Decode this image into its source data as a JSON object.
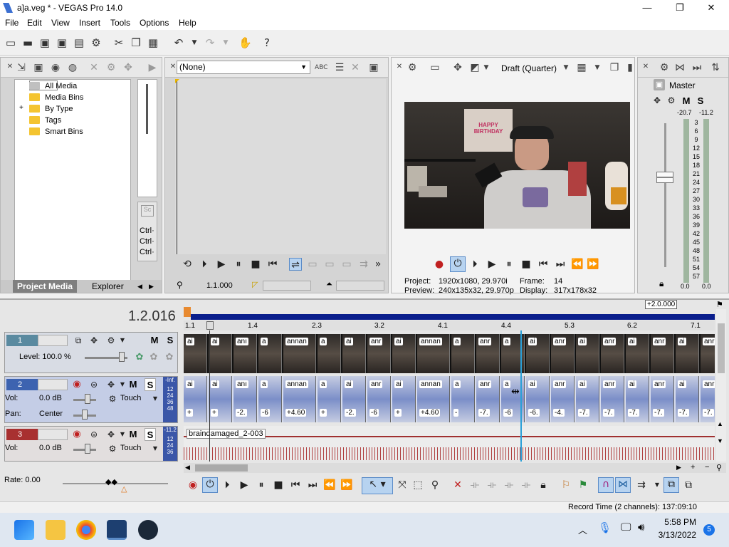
{
  "window": {
    "title": "a]a.veg * - VEGAS Pro 14.0",
    "minimize": "—",
    "maximize": "❐",
    "close": "✕"
  },
  "menu": [
    "File",
    "Edit",
    "View",
    "Insert",
    "Tools",
    "Options",
    "Help"
  ],
  "toolbar_icons": [
    "new-icon",
    "open-icon",
    "save-icon",
    "save-as-icon",
    "render-icon",
    "properties-icon",
    "cut-icon",
    "copy-icon",
    "paste-icon",
    "undo-icon",
    "redo-icon",
    "plugin-icon",
    "help-icon"
  ],
  "project_media": {
    "tree": [
      {
        "label": "All Media",
        "expand": ""
      },
      {
        "label": "Media Bins",
        "expand": ""
      },
      {
        "label": "By Type",
        "expand": "+"
      },
      {
        "label": "Tags",
        "expand": ""
      },
      {
        "label": "Smart Bins",
        "expand": ""
      }
    ],
    "tabs": {
      "project_media": "Project Media",
      "explorer": "Explorer"
    },
    "ctrl_labels": [
      "Ctrl·",
      "Ctrl·",
      "Ctrl·"
    ]
  },
  "trimmer": {
    "dropdown": "(None)",
    "timecode": "1.1.000"
  },
  "preview": {
    "quality": "Draft (Quarter)",
    "project_label": "Project:",
    "project_value": "1920x1080, 29.970i",
    "preview_label": "Preview:",
    "preview_value": "240x135x32, 29.970p",
    "frame_label": "Frame:",
    "frame_value": "14",
    "display_label": "Display:",
    "display_value": "317x178x32",
    "banner_text": "HAPPY BIRTHDAY"
  },
  "master": {
    "title": "Master",
    "m": "M",
    "s": "S",
    "peak_left": "-20.7",
    "peak_right": "-11.2",
    "scale": [
      "3",
      "6",
      "9",
      "12",
      "15",
      "18",
      "21",
      "24",
      "27",
      "30",
      "33",
      "36",
      "39",
      "42",
      "45",
      "48",
      "51",
      "54",
      "57"
    ],
    "level_left": "0.0",
    "level_right": "0.0"
  },
  "timeline": {
    "timecode": "1.2.016",
    "zoom": "+2.0.000",
    "ruler": [
      "1.1",
      "1.4",
      "2.3",
      "3.2",
      "4.1",
      "4.4",
      "5.3",
      "6.2",
      "7.1"
    ],
    "track1": {
      "num": "1",
      "m": "M",
      "s": "S",
      "level": "Level: 100.0 %"
    },
    "track2": {
      "num": "2",
      "m": "M",
      "s": "S",
      "vol_label": "Vol:",
      "vol": "0.0 dB",
      "pan_label": "Pan:",
      "pan": "Center",
      "mode": "Touch",
      "meter": [
        "-Inf.",
        "12",
        "24",
        "36",
        "48"
      ]
    },
    "track3": {
      "num": "3",
      "m": "M",
      "s": "S",
      "vol_label": "Vol:",
      "vol": "0.0 dB",
      "mode": "Touch",
      "meter": [
        "-11.2",
        "12",
        "24",
        "36"
      ],
      "clip": "braindamaged_2-003"
    },
    "video_caps": [
      "ai",
      "ai",
      "anı",
      "a",
      "annan",
      "a",
      "ai",
      "anr",
      "ai",
      "annan",
      "a",
      "anr",
      "a",
      "ai",
      "anr",
      "ai",
      "anr",
      "ai",
      "anr",
      "ai",
      "anr"
    ],
    "audio_caps": [
      "ai",
      "ai",
      "anı",
      "a",
      "annan",
      "a",
      "ai",
      "anr",
      "ai",
      "annan",
      "a",
      "anr",
      "a",
      "ai",
      "anr",
      "ai",
      "anr",
      "ai",
      "anr",
      "ai",
      "anr"
    ],
    "audio_vals": [
      "+",
      "+",
      "-2.",
      "-6",
      "+4.60",
      "+",
      "-2.",
      "-6",
      "+",
      "+4.60",
      "-",
      "-7.",
      "-6",
      "-6.",
      "-4.",
      "-7.",
      "-7.",
      "-7.",
      "-7.",
      "-7.",
      "-7."
    ],
    "rate": "Rate: 0.00"
  },
  "status": {
    "record_time": "Record Time (2 channels): 137:09:10"
  },
  "taskbar": {
    "time": "5:58 PM",
    "date": "3/13/2022",
    "badge": "5"
  }
}
